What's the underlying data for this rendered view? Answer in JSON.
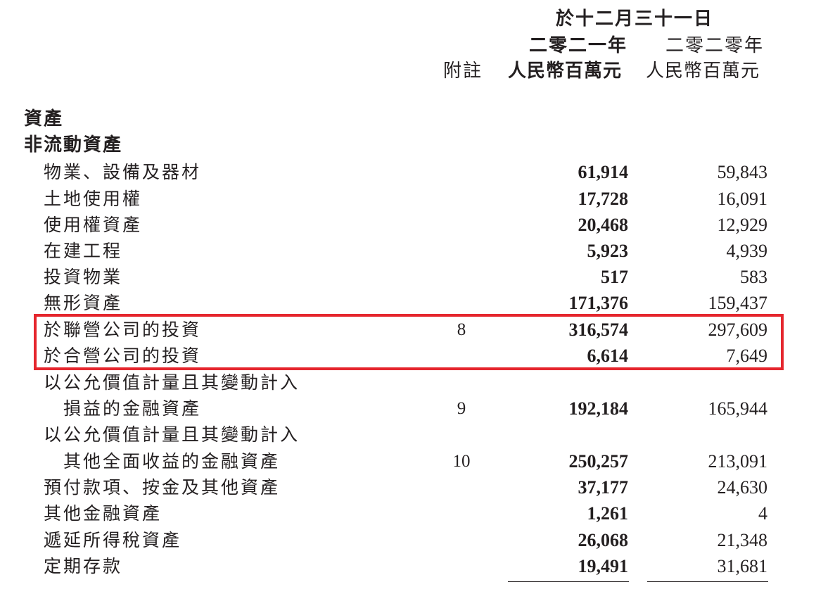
{
  "header": {
    "date_line": "於十二月三十一日",
    "year_current": "二零二一年",
    "year_prior": "二零二零年",
    "note_label": "附註",
    "unit_current": "人民幣百萬元",
    "unit_prior": "人民幣百萬元"
  },
  "sections": {
    "assets": "資產",
    "non_current_assets": "非流動資產"
  },
  "rows": [
    {
      "label": "物業、設備及器材",
      "note": "",
      "v2021": "61,914",
      "v2020": "59,843"
    },
    {
      "label": "土地使用權",
      "note": "",
      "v2021": "17,728",
      "v2020": "16,091"
    },
    {
      "label": "使用權資產",
      "note": "",
      "v2021": "20,468",
      "v2020": "12,929"
    },
    {
      "label": "在建工程",
      "note": "",
      "v2021": "5,923",
      "v2020": "4,939"
    },
    {
      "label": "投資物業",
      "note": "",
      "v2021": "517",
      "v2020": "583"
    },
    {
      "label": "無形資產",
      "note": "",
      "v2021": "171,376",
      "v2020": "159,437"
    },
    {
      "label": "於聯營公司的投資",
      "note": "8",
      "v2021": "316,574",
      "v2020": "297,609"
    },
    {
      "label": "於合營公司的投資",
      "note": "",
      "v2021": "6,614",
      "v2020": "7,649"
    },
    {
      "label": "以公允價值計量且其變動計入",
      "label2": "損益的金融資產",
      "note": "9",
      "v2021": "192,184",
      "v2020": "165,944"
    },
    {
      "label": "以公允價值計量且其變動計入",
      "label2": "其他全面收益的金融資產",
      "note": "10",
      "v2021": "250,257",
      "v2020": "213,091"
    },
    {
      "label": "預付款項、按金及其他資產",
      "note": "",
      "v2021": "37,177",
      "v2020": "24,630"
    },
    {
      "label": "其他金融資產",
      "note": "",
      "v2021": "1,261",
      "v2020": "4"
    },
    {
      "label": "遞延所得稅資產",
      "note": "",
      "v2021": "26,068",
      "v2020": "21,348"
    },
    {
      "label": "定期存款",
      "note": "",
      "v2021": "19,491",
      "v2020": "31,681"
    }
  ],
  "colors": {
    "highlight": "#e5262d",
    "text": "#231f20"
  }
}
